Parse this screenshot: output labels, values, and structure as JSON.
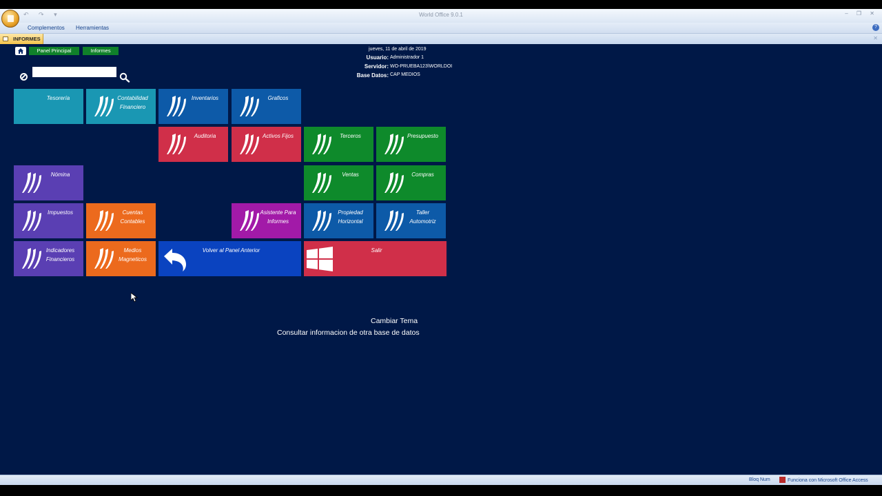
{
  "window": {
    "title": "World Office 9.0.1"
  },
  "menu": {
    "complementos": "Complementos",
    "herramientas": "Herramientas"
  },
  "tab": {
    "label": "INFORMES"
  },
  "breadcrumb": {
    "panel_principal": "Panel Principal",
    "informes": "Informes"
  },
  "session": {
    "date": "jueves, 11 de abril de 2019",
    "usuario_label": "Usuario:",
    "usuario": "Administrador 1",
    "servidor_label": "Servidor:",
    "servidor": "WO-PRUEBA123\\WORLDOI",
    "base_label": "Base Datos:",
    "base": "CAP MEDIOS"
  },
  "search": {
    "value": "",
    "placeholder": ""
  },
  "tiles": {
    "tesoreria": {
      "line1": "Tesorería",
      "color": "#1a97b3"
    },
    "contabilidad": {
      "line1": "Contabilidad",
      "line2": "Financiero",
      "color": "#1a97b3"
    },
    "inventarios": {
      "line1": "Inventarios",
      "color": "#0d5aa8"
    },
    "graficos": {
      "line1": "Graficos",
      "color": "#0d5aa8"
    },
    "auditoria": {
      "line1": "Auditoria",
      "color": "#d02f49"
    },
    "activos": {
      "line1": "Activos Fijos",
      "color": "#d02f49"
    },
    "terceros": {
      "line1": "Terceros",
      "color": "#0e8a2b"
    },
    "presupuesto": {
      "line1": "Presupuesto",
      "color": "#0e8a2b"
    },
    "nomina": {
      "line1": "Nómina",
      "color": "#5a3fb3"
    },
    "ventas": {
      "line1": "Ventas",
      "color": "#0e8a2b"
    },
    "compras": {
      "line1": "Compras",
      "color": "#0e8a2b"
    },
    "impuestos": {
      "line1": "Impuestos",
      "color": "#5a3fb3"
    },
    "cuentas": {
      "line1": "Cuentas",
      "line2": "Contables",
      "color": "#ec6a1d"
    },
    "asistente": {
      "line1": "Asistente Para",
      "line2": "Informes",
      "color": "#a21aa8"
    },
    "propiedad": {
      "line1": "Propiedad",
      "line2": "Horizontal",
      "color": "#0d5aa8"
    },
    "taller": {
      "line1": "Taller",
      "line2": "Automotriz",
      "color": "#0d5aa8"
    },
    "indicadores": {
      "line1": "Indicadores",
      "line2": "Financieros",
      "color": "#5a3fb3"
    },
    "medios": {
      "line1": "Medios",
      "line2": "Magneticos",
      "color": "#ec6a1d"
    },
    "volver": {
      "line1": "Volver al Panel Anterior",
      "color": "#0a43c0"
    },
    "salir": {
      "line1": "Salir",
      "color": "#d02f49"
    }
  },
  "links": {
    "cambiar_tema": "Cambiar Tema",
    "consultar": "Consultar informacion de otra base de datos"
  },
  "status": {
    "num": "Bloq Num",
    "access": "Funciona con Microsoft Office Access"
  }
}
